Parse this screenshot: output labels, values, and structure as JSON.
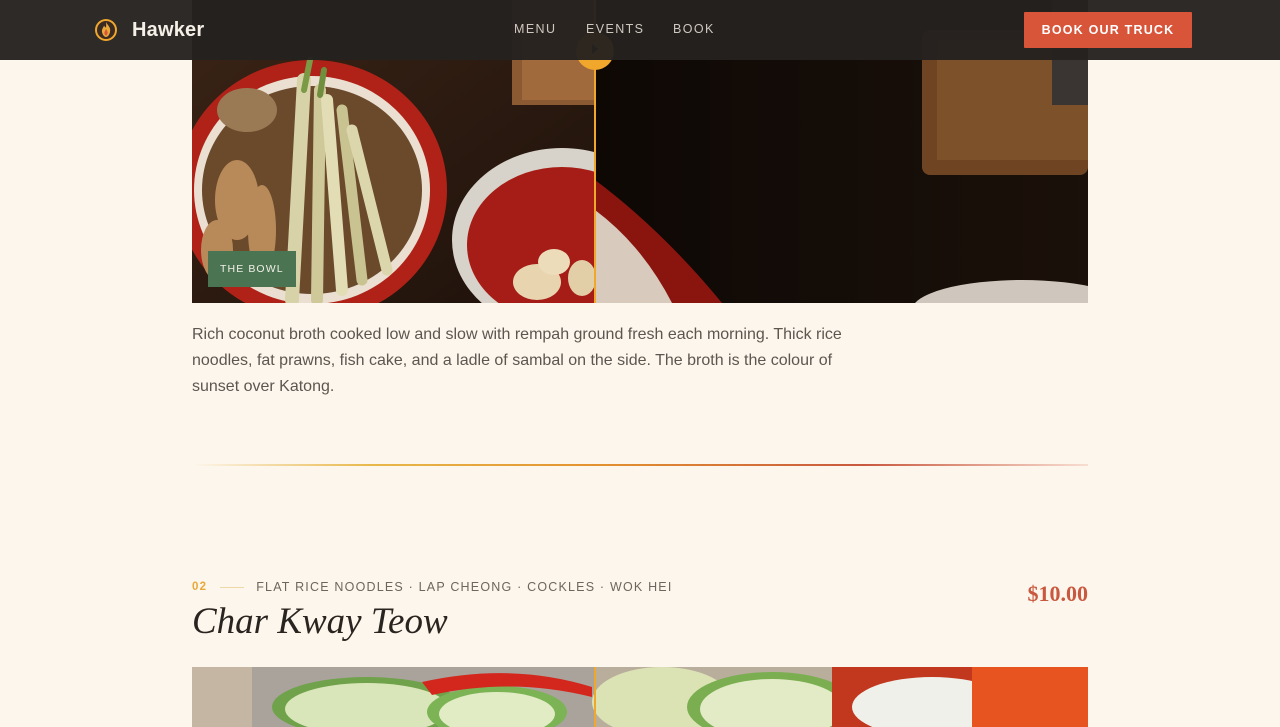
{
  "header": {
    "brand_name": "Hawker",
    "brand_icon": "flame-logo-icon",
    "nav": [
      {
        "label": "MENU"
      },
      {
        "label": "EVENTS"
      },
      {
        "label": "BOOK"
      }
    ],
    "cta_label": "BOOK OUR TRUCK"
  },
  "dish_1": {
    "badge": "THE BOWL",
    "description": "Rich coconut broth cooked low and slow with rempah ground fresh each morning. Thick rice noodles, fat prawns, fish cake, and a ladle of sambal on the side. The broth is the colour of sunset over Katong.",
    "compare_handle_icon": "slider-arrow-icon"
  },
  "dish_2": {
    "number": "02",
    "tags": "FLAT RICE NOODLES · LAP CHEONG · COCKLES · WOK HEI",
    "title": "Char Kway Teow",
    "price": "$10.00"
  },
  "colors": {
    "background": "#fdf6ec",
    "header_bg": "#24211f",
    "accent": "#d9553a",
    "gold": "#f1a72b",
    "badge_green": "#4b7452"
  }
}
